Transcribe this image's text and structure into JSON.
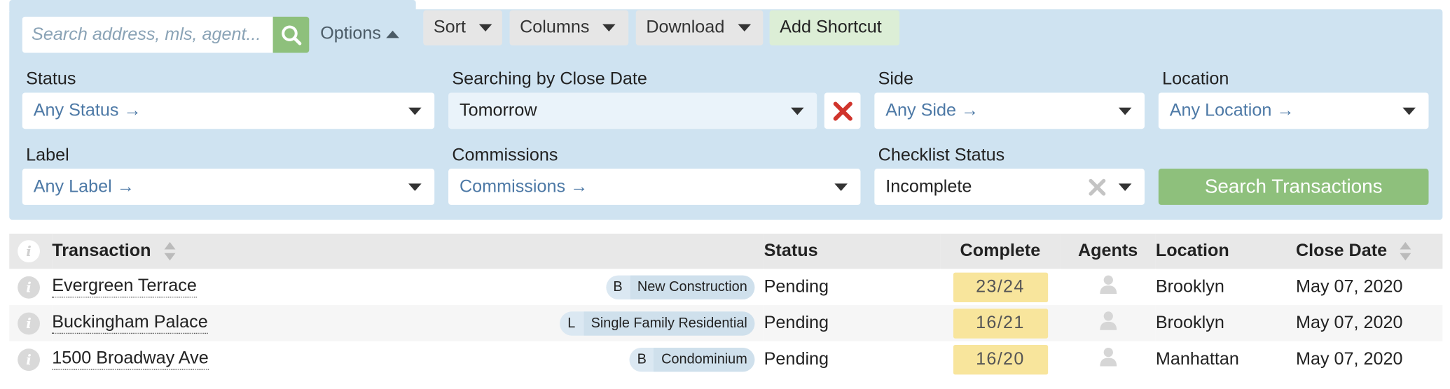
{
  "search": {
    "placeholder": "Search address, mls, agent..."
  },
  "toolbar": {
    "options_label": "Options",
    "sort_label": "Sort",
    "columns_label": "Columns",
    "download_label": "Download",
    "add_shortcut_label": "Add Shortcut"
  },
  "filters": {
    "status": {
      "label": "Status",
      "value": "Any Status →"
    },
    "close_date": {
      "label": "Searching by Close Date",
      "value": "Tomorrow"
    },
    "side": {
      "label": "Side",
      "value": "Any Side →"
    },
    "location": {
      "label": "Location",
      "value": "Any Location →"
    },
    "tag": {
      "label": "Label",
      "value": "Any Label →"
    },
    "commissions": {
      "label": "Commissions",
      "value": "Commissions →"
    },
    "checklist": {
      "label": "Checklist Status",
      "value": "Incomplete"
    },
    "search_button": "Search Transactions"
  },
  "table": {
    "headers": {
      "info": "i",
      "transaction": "Transaction",
      "status": "Status",
      "complete": "Complete",
      "agents": "Agents",
      "location": "Location",
      "close_date": "Close Date"
    },
    "rows": [
      {
        "info": "i",
        "name": "Evergreen Terrace",
        "side": "B",
        "type": "New Construction",
        "status": "Pending",
        "complete": "23/24",
        "location": "Brooklyn",
        "close_date": "May 07, 2020"
      },
      {
        "info": "i",
        "name": "Buckingham Palace",
        "side": "L",
        "type": "Single Family Residential",
        "status": "Pending",
        "complete": "16/21",
        "location": "Brooklyn",
        "close_date": "May 07, 2020"
      },
      {
        "info": "i",
        "name": "1500 Broadway Ave",
        "side": "B",
        "type": "Condominium",
        "status": "Pending",
        "complete": "16/20",
        "location": "Manhattan",
        "close_date": "May 07, 2020"
      }
    ]
  },
  "colors": {
    "panel": "#cfe3f1",
    "accent_green": "#8ec07c",
    "link_blue": "#4d79a6",
    "complete_pill": "#f8e59c",
    "clear_red": "#d0342c"
  },
  "icons": {
    "search": "search-icon",
    "clear": "close-icon",
    "sort": "sort-icon",
    "info": "info-icon",
    "agent": "user-icon"
  }
}
